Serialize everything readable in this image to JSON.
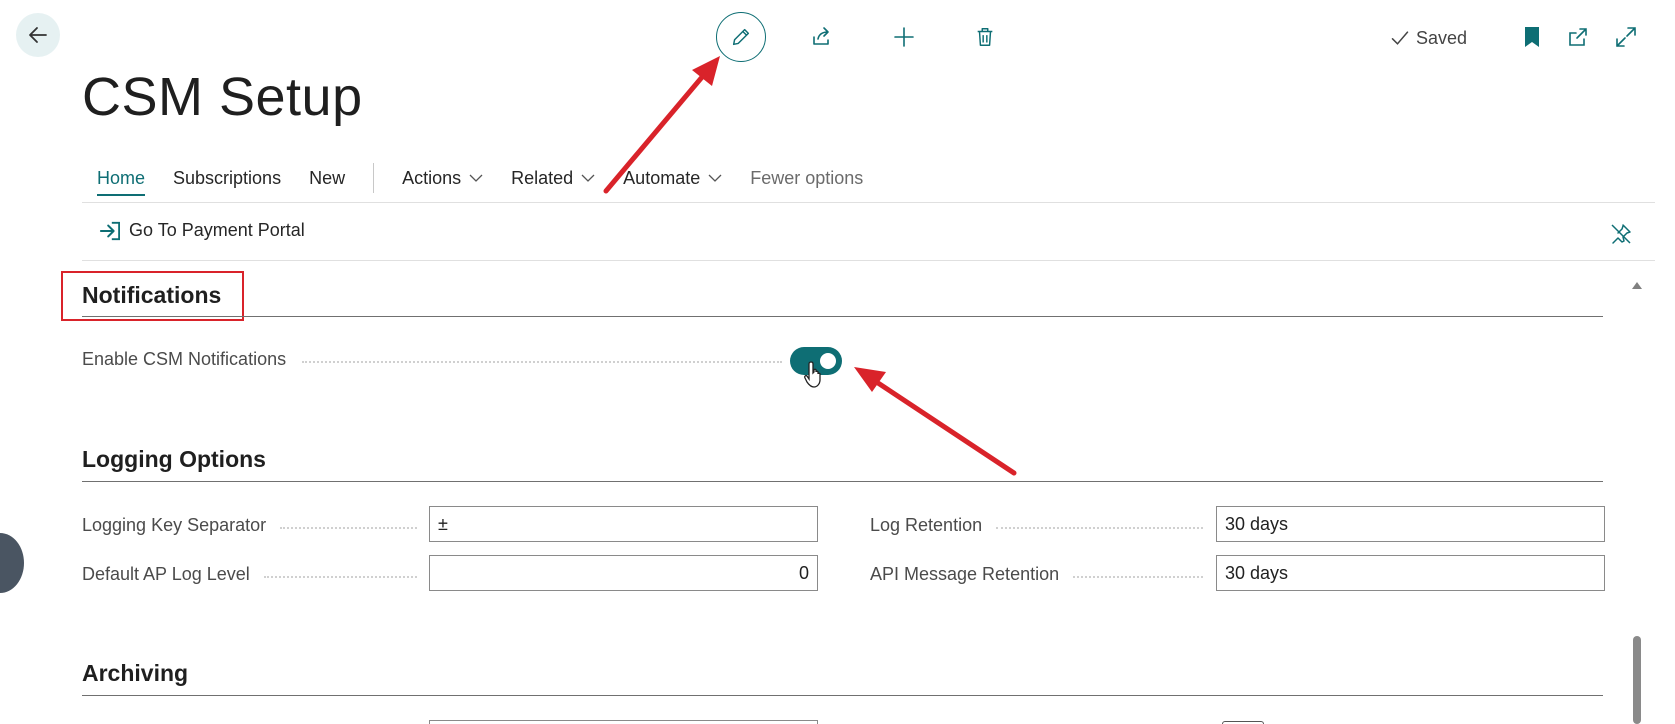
{
  "header": {
    "saved_label": "Saved"
  },
  "page": {
    "title": "CSM Setup"
  },
  "nav": {
    "home": "Home",
    "subscriptions": "Subscriptions",
    "new": "New",
    "actions": "Actions",
    "related": "Related",
    "automate": "Automate",
    "fewer_options": "Fewer options"
  },
  "promoted": {
    "go_to_portal": "Go To Payment Portal"
  },
  "sections": {
    "notifications": {
      "title": "Notifications",
      "enable_label": "Enable CSM Notifications",
      "enable_value": true
    },
    "logging": {
      "title": "Logging Options",
      "key_separator_label": "Logging Key Separator",
      "key_separator_value": "±",
      "default_log_level_label": "Default AP Log Level",
      "default_log_level_value": "0",
      "log_retention_label": "Log Retention",
      "log_retention_value": "30 days",
      "api_retention_label": "API Message Retention",
      "api_retention_value": "30 days"
    },
    "archiving": {
      "title": "Archiving"
    }
  },
  "colors": {
    "accent": "#0e6e74",
    "annotation": "#d9232a"
  }
}
